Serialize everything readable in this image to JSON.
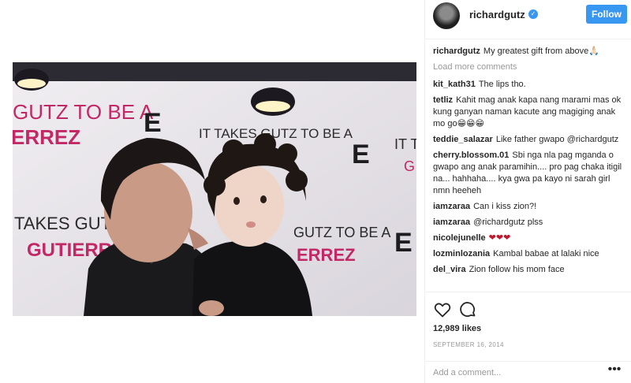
{
  "post": {
    "photo_backdrop": {
      "lines": [
        "GUTZ TO BE A",
        "ERREZ",
        "IT TAKES GUTZ TO BE A",
        "TAKES GUTZ",
        "GUTIERRE",
        "GUTZ TO BE A",
        "ERREZ",
        "IT T",
        "G"
      ],
      "logo": "E"
    },
    "colors": {
      "accent": "#3897f0",
      "backdrop_pink": "#c22866"
    }
  },
  "header": {
    "username": "richardgutz",
    "verified_icon": "verified-badge-icon",
    "follow_label": "Follow"
  },
  "caption": {
    "user": "richardgutz",
    "text": "My greatest gift from above🙏🏻"
  },
  "load_more": "Load more comments",
  "comments": [
    {
      "user": "kit_kath31",
      "text": "The lips tho."
    },
    {
      "user": "tetliz",
      "text": "Kahit mag anak kapa nang marami mas ok kung ganyan naman kacute ang magiging anak mo go😁😁😁"
    },
    {
      "user": "teddie_salazar",
      "text": "Like father gwapo @richardgutz"
    },
    {
      "user": "cherry.blossom.01",
      "text": "Sbi nga nla pag mganda o gwapo ang anak paramihin.... pro pag chaka itigil na... hahhaha.... kya gwa pa kayo ni sarah girl nmn heeheh"
    },
    {
      "user": "iamzaraa",
      "text": "Can i kiss zion?!"
    },
    {
      "user": "iamzaraa",
      "text": "@richardgutz plss"
    },
    {
      "user": "nicolejunelle",
      "text": "❤❤❤"
    },
    {
      "user": "lozminlozania",
      "text": "Kambal babae at lalaki nice"
    },
    {
      "user": "del_vira",
      "text": "Zion follow his mom face"
    }
  ],
  "actions": {
    "like_icon": "heart-icon",
    "comment_icon": "comment-icon"
  },
  "likes": "12,989 likes",
  "date": "September 16, 2014",
  "add_comment": {
    "placeholder": "Add a comment...",
    "more_icon": "ellipsis-icon"
  }
}
